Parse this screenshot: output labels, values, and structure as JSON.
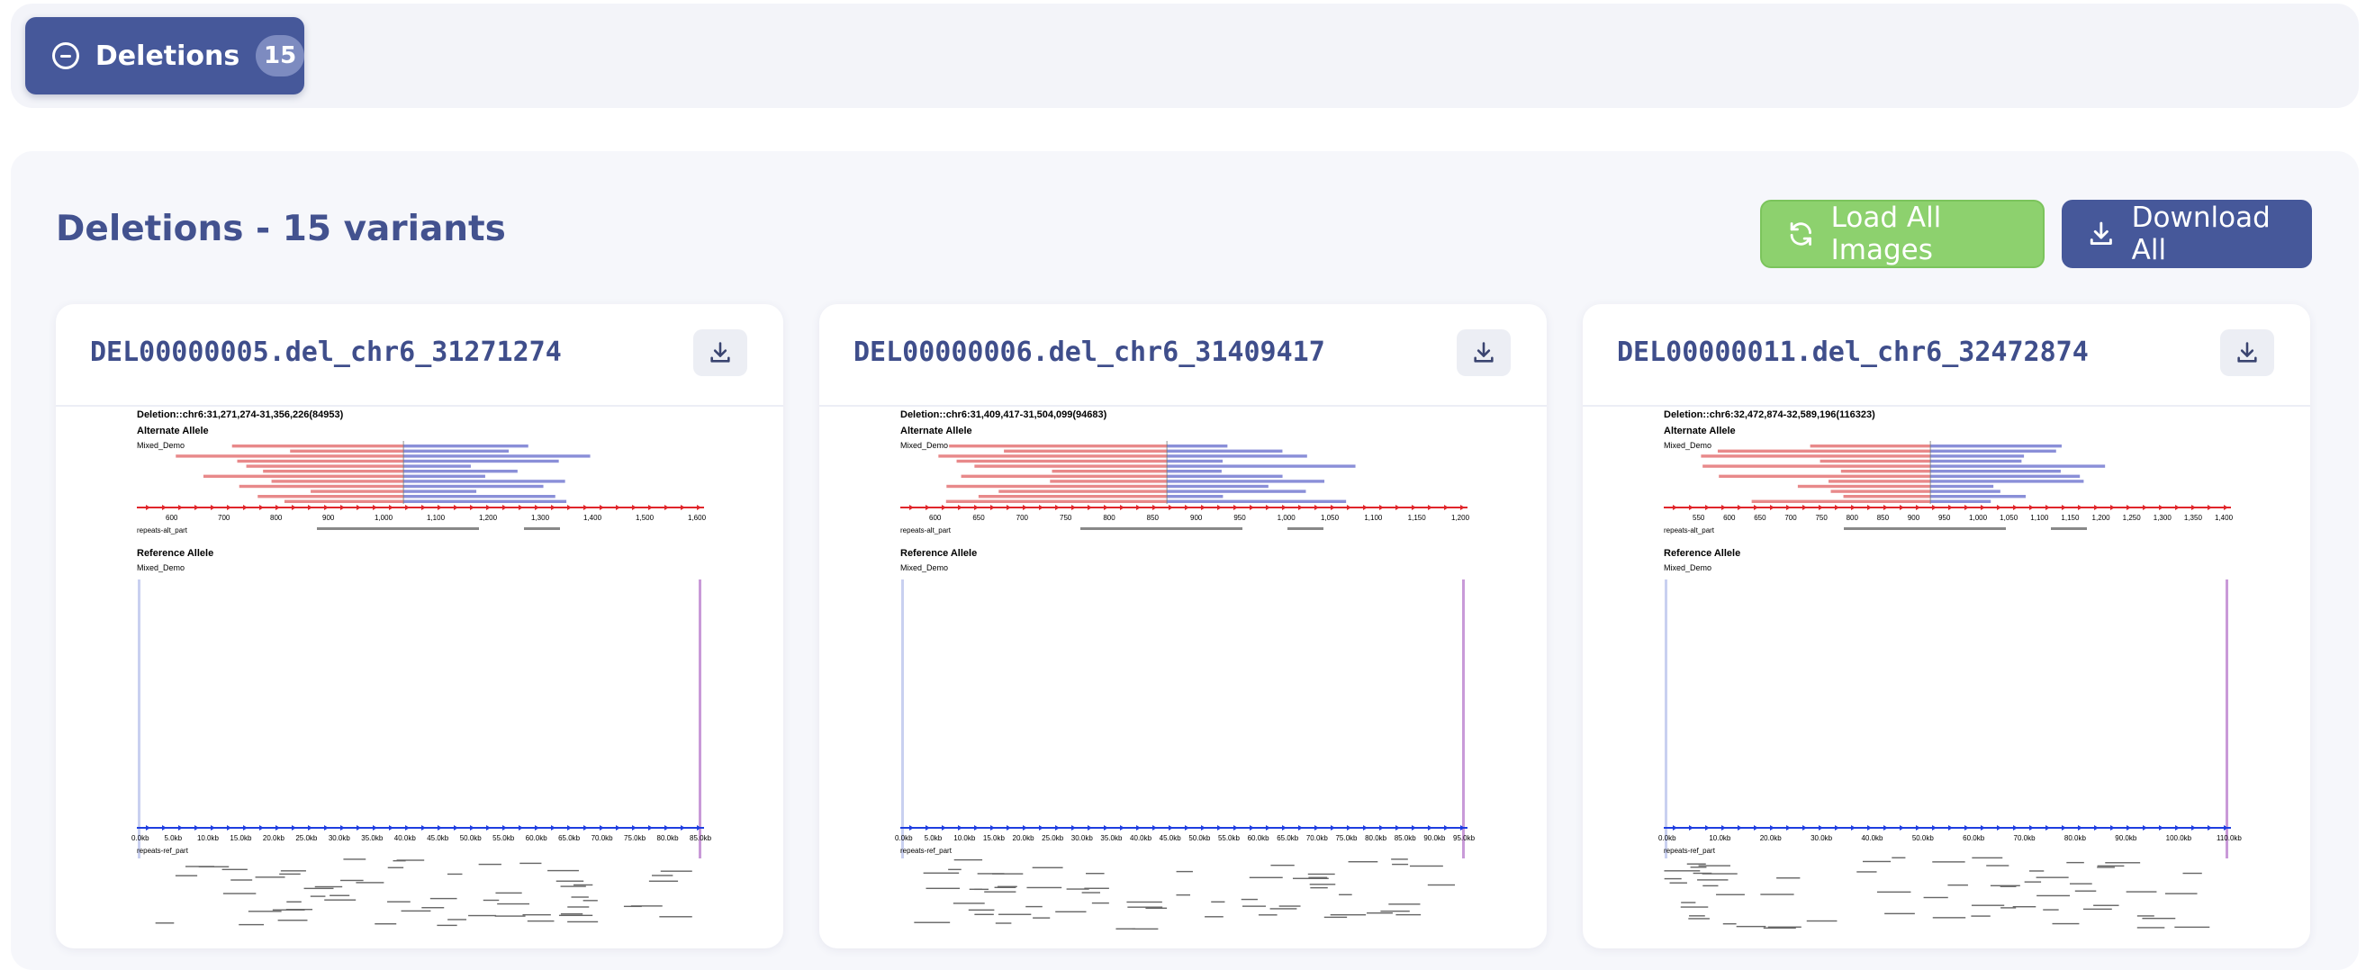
{
  "toggle": {
    "label": "Deletions",
    "count": "15",
    "icon": "minus-circle-icon"
  },
  "panel": {
    "title": "Deletions - 15 variants",
    "load_all_label": "Load All Images",
    "download_all_label": "Download All"
  },
  "colors": {
    "primary": "#46589a",
    "success": "#8dd16e",
    "alt_reads": "#e8898a",
    "ref_reads": "#8a8fd8",
    "forward_strand": "#e0262b",
    "reference_strand": "#1f3ee0"
  },
  "cards": [
    {
      "title": "DEL00000005.del_chr6_31271274",
      "plot": {
        "header": "Deletion::chr6:31,271,274-31,356,226(84953)",
        "alt_label": "Alternate Allele",
        "sample": "Mixed_Demo",
        "alt_ticks": [
          "600",
          "700",
          "800",
          "900",
          "1,000",
          "1,100",
          "1,200",
          "1,300",
          "1,400",
          "1,500",
          "1,600"
        ],
        "track_label": "repeats-alt_part",
        "ref_label": "Reference Allele",
        "ref_ticks": [
          "0.0kb",
          "5.0kb",
          "10.0kb",
          "15.0kb",
          "20.0kb",
          "25.0kb",
          "30.0kb",
          "35.0kb",
          "40.0kb",
          "45.0kb",
          "50.0kb",
          "55.0kb",
          "60.0kb",
          "65.0kb",
          "70.0kb",
          "75.0kb",
          "80.0kb",
          "85.0kb"
        ],
        "ref_track_label": "repeats-ref_part"
      }
    },
    {
      "title": "DEL00000006.del_chr6_31409417",
      "plot": {
        "header": "Deletion::chr6:31,409,417-31,504,099(94683)",
        "alt_label": "Alternate Allele",
        "sample": "Mixed_Demo",
        "alt_ticks": [
          "600",
          "650",
          "700",
          "750",
          "800",
          "850",
          "900",
          "950",
          "1,000",
          "1,050",
          "1,100",
          "1,150",
          "1,200"
        ],
        "track_label": "repeats-alt_part",
        "ref_label": "Reference Allele",
        "ref_ticks": [
          "0.0kb",
          "5.0kb",
          "10.0kb",
          "15.0kb",
          "20.0kb",
          "25.0kb",
          "30.0kb",
          "35.0kb",
          "40.0kb",
          "45.0kb",
          "50.0kb",
          "55.0kb",
          "60.0kb",
          "65.0kb",
          "70.0kb",
          "75.0kb",
          "80.0kb",
          "85.0kb",
          "90.0kb",
          "95.0kb"
        ],
        "ref_track_label": "repeats-ref_part"
      }
    },
    {
      "title": "DEL00000011.del_chr6_32472874",
      "plot": {
        "header": "Deletion::chr6:32,472,874-32,589,196(116323)",
        "alt_label": "Alternate Allele",
        "sample": "Mixed_Demo",
        "alt_ticks": [
          "550",
          "600",
          "650",
          "700",
          "750",
          "800",
          "850",
          "900",
          "950",
          "1,000",
          "1,050",
          "1,100",
          "1,150",
          "1,200",
          "1,250",
          "1,300",
          "1,350",
          "1,400"
        ],
        "track_label": "repeats-alt_part",
        "ref_label": "Reference Allele",
        "ref_ticks": [
          "0.0kb",
          "10.0kb",
          "20.0kb",
          "30.0kb",
          "40.0kb",
          "50.0kb",
          "60.0kb",
          "70.0kb",
          "80.0kb",
          "90.0kb",
          "100.0kb",
          "110.0kb"
        ],
        "ref_track_label": "repeats-ref_part"
      }
    }
  ]
}
